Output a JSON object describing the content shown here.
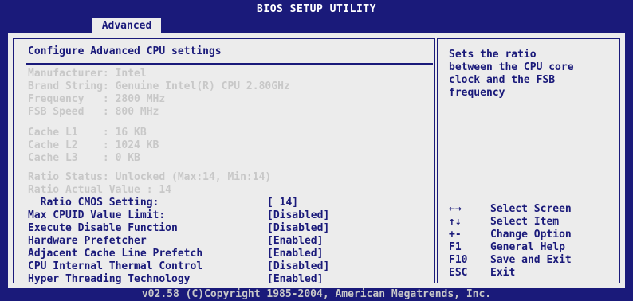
{
  "window": {
    "title": "BIOS SETUP UTILITY"
  },
  "tabs": [
    {
      "label": "Advanced",
      "active": true
    }
  ],
  "main": {
    "section_title": "Configure Advanced CPU settings",
    "info_lines": [
      "Manufacturer: Intel",
      "Brand String: Genuine Intel(R) CPU 2.80GHz",
      "Frequency   : 2800 MHz",
      "FSB Speed   : 800 MHz",
      "",
      "Cache L1    : 16 KB",
      "Cache L2    : 1024 KB",
      "Cache L3    : 0 KB",
      "",
      "Ratio Status: Unlocked (Max:14, Min:14)",
      "Ratio Actual Value : 14"
    ],
    "settings": [
      {
        "label": "  Ratio CMOS Setting:",
        "value": "[ 14]"
      },
      {
        "label": "Max CPUID Value Limit:",
        "value": "[Disabled]"
      },
      {
        "label": "Execute Disable Function",
        "value": "[Disabled]"
      },
      {
        "label": "Hardware Prefetcher",
        "value": "[Enabled]"
      },
      {
        "label": "Adjacent Cache Line Prefetch",
        "value": "[Enabled]"
      },
      {
        "label": "CPU Internal Thermal Control",
        "value": "[Disabled]"
      },
      {
        "label": "Hyper Threading Technology",
        "value": "[Enabled]"
      }
    ]
  },
  "help": {
    "text": "Sets the ratio\nbetween the CPU core\nclock and the FSB\nfrequency",
    "keys": [
      {
        "key": "←→",
        "desc": "Select Screen"
      },
      {
        "key": "↑↓",
        "desc": "Select Item"
      },
      {
        "key": "+-",
        "desc": "Change Option"
      },
      {
        "key": "F1",
        "desc": "General Help"
      },
      {
        "key": "F10",
        "desc": "Save and Exit"
      },
      {
        "key": "ESC",
        "desc": "Exit"
      }
    ]
  },
  "footer": {
    "copyright": "v02.58 (C)Copyright 1985-2004, American Megatrends, Inc."
  },
  "colors": {
    "background": "#1a1a7a",
    "panel": "#ececec",
    "text": "#1a1a7a",
    "dim_text": "#c8c8c8"
  }
}
